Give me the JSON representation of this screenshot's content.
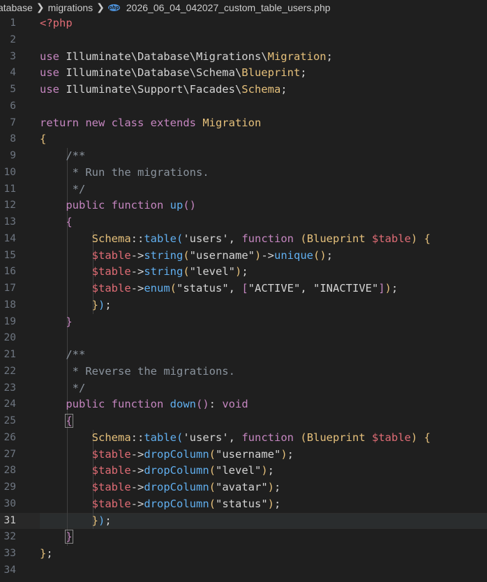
{
  "breadcrumb": {
    "items": [
      "atabase",
      "migrations"
    ],
    "file_icon": "php",
    "file_name": "2026_06_04_042027_custom_table_users.php"
  },
  "editor": {
    "current_line": 31,
    "line_numbers": [
      "1",
      "2",
      "3",
      "4",
      "5",
      "6",
      "7",
      "8",
      "9",
      "10",
      "11",
      "12",
      "13",
      "14",
      "15",
      "16",
      "17",
      "18",
      "19",
      "20",
      "21",
      "22",
      "23",
      "24",
      "25",
      "26",
      "27",
      "28",
      "29",
      "30",
      "31",
      "32",
      "33",
      "34"
    ],
    "lines": [
      [
        {
          "c": "tag",
          "t": "<?php"
        }
      ],
      [],
      [
        {
          "c": "kw",
          "t": "use "
        },
        {
          "c": "ns",
          "t": "Illuminate\\Database\\Migrations\\"
        },
        {
          "c": "cls",
          "t": "Migration"
        },
        {
          "c": "op",
          "t": ";"
        }
      ],
      [
        {
          "c": "kw",
          "t": "use "
        },
        {
          "c": "ns",
          "t": "Illuminate\\Database\\Schema\\"
        },
        {
          "c": "cls",
          "t": "Blueprint"
        },
        {
          "c": "op",
          "t": ";"
        }
      ],
      [
        {
          "c": "kw",
          "t": "use "
        },
        {
          "c": "ns",
          "t": "Illuminate\\Support\\Facades\\"
        },
        {
          "c": "cls",
          "t": "Schema"
        },
        {
          "c": "op",
          "t": ";"
        }
      ],
      [],
      [
        {
          "c": "kw",
          "t": "return "
        },
        {
          "c": "kw",
          "t": "new "
        },
        {
          "c": "kw",
          "t": "class "
        },
        {
          "c": "kw",
          "t": "extends "
        },
        {
          "c": "cls",
          "t": "Migration"
        }
      ],
      [
        {
          "c": "br1",
          "t": "{"
        }
      ],
      [
        {
          "c": "op",
          "t": "    "
        },
        {
          "c": "cmt",
          "t": "/**"
        }
      ],
      [
        {
          "c": "op",
          "t": "     "
        },
        {
          "c": "cmt",
          "t": "* Run the migrations."
        }
      ],
      [
        {
          "c": "op",
          "t": "     "
        },
        {
          "c": "cmt",
          "t": "*/"
        }
      ],
      [
        {
          "c": "op",
          "t": "    "
        },
        {
          "c": "kw",
          "t": "public "
        },
        {
          "c": "kw",
          "t": "function "
        },
        {
          "c": "fn",
          "t": "up"
        },
        {
          "c": "br2",
          "t": "()"
        }
      ],
      [
        {
          "c": "op",
          "t": "    "
        },
        {
          "c": "br2",
          "t": "{"
        }
      ],
      [
        {
          "c": "op",
          "t": "        "
        },
        {
          "c": "cls",
          "t": "Schema"
        },
        {
          "c": "op",
          "t": "::"
        },
        {
          "c": "fn",
          "t": "table"
        },
        {
          "c": "br3",
          "t": "("
        },
        {
          "c": "str",
          "t": "'users'"
        },
        {
          "c": "op",
          "t": ", "
        },
        {
          "c": "kw",
          "t": "function "
        },
        {
          "c": "br1",
          "t": "("
        },
        {
          "c": "cls",
          "t": "Blueprint "
        },
        {
          "c": "var",
          "t": "$table"
        },
        {
          "c": "br1",
          "t": ")"
        },
        {
          "c": "op",
          "t": " "
        },
        {
          "c": "br1",
          "t": "{"
        }
      ],
      [
        {
          "c": "op",
          "t": "        "
        },
        {
          "c": "var",
          "t": "$table"
        },
        {
          "c": "op",
          "t": "->"
        },
        {
          "c": "fn",
          "t": "string"
        },
        {
          "c": "br1",
          "t": "("
        },
        {
          "c": "str",
          "t": "\"username\""
        },
        {
          "c": "br1",
          "t": ")"
        },
        {
          "c": "op",
          "t": "->"
        },
        {
          "c": "fn",
          "t": "unique"
        },
        {
          "c": "br1",
          "t": "()"
        },
        {
          "c": "op",
          "t": ";"
        }
      ],
      [
        {
          "c": "op",
          "t": "        "
        },
        {
          "c": "var",
          "t": "$table"
        },
        {
          "c": "op",
          "t": "->"
        },
        {
          "c": "fn",
          "t": "string"
        },
        {
          "c": "br1",
          "t": "("
        },
        {
          "c": "str",
          "t": "\"level\""
        },
        {
          "c": "br1",
          "t": ")"
        },
        {
          "c": "op",
          "t": ";"
        }
      ],
      [
        {
          "c": "op",
          "t": "        "
        },
        {
          "c": "var",
          "t": "$table"
        },
        {
          "c": "op",
          "t": "->"
        },
        {
          "c": "fn",
          "t": "enum"
        },
        {
          "c": "br1",
          "t": "("
        },
        {
          "c": "str",
          "t": "\"status\""
        },
        {
          "c": "op",
          "t": ", "
        },
        {
          "c": "br2",
          "t": "["
        },
        {
          "c": "str",
          "t": "\"ACTIVE\""
        },
        {
          "c": "op",
          "t": ", "
        },
        {
          "c": "str",
          "t": "\"INACTIVE\""
        },
        {
          "c": "br2",
          "t": "]"
        },
        {
          "c": "br1",
          "t": ")"
        },
        {
          "c": "op",
          "t": ";"
        }
      ],
      [
        {
          "c": "op",
          "t": "        "
        },
        {
          "c": "br1",
          "t": "}"
        },
        {
          "c": "br3",
          "t": ")"
        },
        {
          "c": "op",
          "t": ";"
        }
      ],
      [
        {
          "c": "op",
          "t": "    "
        },
        {
          "c": "br2",
          "t": "}"
        }
      ],
      [],
      [
        {
          "c": "op",
          "t": "    "
        },
        {
          "c": "cmt",
          "t": "/**"
        }
      ],
      [
        {
          "c": "op",
          "t": "     "
        },
        {
          "c": "cmt",
          "t": "* Reverse the migrations."
        }
      ],
      [
        {
          "c": "op",
          "t": "     "
        },
        {
          "c": "cmt",
          "t": "*/"
        }
      ],
      [
        {
          "c": "op",
          "t": "    "
        },
        {
          "c": "kw",
          "t": "public "
        },
        {
          "c": "kw",
          "t": "function "
        },
        {
          "c": "fn",
          "t": "down"
        },
        {
          "c": "br2",
          "t": "()"
        },
        {
          "c": "op",
          "t": ": "
        },
        {
          "c": "type",
          "t": "void"
        }
      ],
      [
        {
          "c": "op",
          "t": "    "
        },
        {
          "c": "br2 boxb",
          "t": "{"
        }
      ],
      [
        {
          "c": "op",
          "t": "        "
        },
        {
          "c": "cls",
          "t": "Schema"
        },
        {
          "c": "op",
          "t": "::"
        },
        {
          "c": "fn",
          "t": "table"
        },
        {
          "c": "br3",
          "t": "("
        },
        {
          "c": "str",
          "t": "'users'"
        },
        {
          "c": "op",
          "t": ", "
        },
        {
          "c": "kw",
          "t": "function "
        },
        {
          "c": "br1",
          "t": "("
        },
        {
          "c": "cls",
          "t": "Blueprint "
        },
        {
          "c": "var",
          "t": "$table"
        },
        {
          "c": "br1",
          "t": ")"
        },
        {
          "c": "op",
          "t": " "
        },
        {
          "c": "br1",
          "t": "{"
        }
      ],
      [
        {
          "c": "op",
          "t": "        "
        },
        {
          "c": "var",
          "t": "$table"
        },
        {
          "c": "op",
          "t": "->"
        },
        {
          "c": "fn",
          "t": "dropColumn"
        },
        {
          "c": "br1",
          "t": "("
        },
        {
          "c": "str",
          "t": "\"username\""
        },
        {
          "c": "br1",
          "t": ")"
        },
        {
          "c": "op",
          "t": ";"
        }
      ],
      [
        {
          "c": "op",
          "t": "        "
        },
        {
          "c": "var",
          "t": "$table"
        },
        {
          "c": "op",
          "t": "->"
        },
        {
          "c": "fn",
          "t": "dropColumn"
        },
        {
          "c": "br1",
          "t": "("
        },
        {
          "c": "str",
          "t": "\"level\""
        },
        {
          "c": "br1",
          "t": ")"
        },
        {
          "c": "op",
          "t": ";"
        }
      ],
      [
        {
          "c": "op",
          "t": "        "
        },
        {
          "c": "var",
          "t": "$table"
        },
        {
          "c": "op",
          "t": "->"
        },
        {
          "c": "fn",
          "t": "dropColumn"
        },
        {
          "c": "br1",
          "t": "("
        },
        {
          "c": "str",
          "t": "\"avatar\""
        },
        {
          "c": "br1",
          "t": ")"
        },
        {
          "c": "op",
          "t": ";"
        }
      ],
      [
        {
          "c": "op",
          "t": "        "
        },
        {
          "c": "var",
          "t": "$table"
        },
        {
          "c": "op",
          "t": "->"
        },
        {
          "c": "fn",
          "t": "dropColumn"
        },
        {
          "c": "br1",
          "t": "("
        },
        {
          "c": "str",
          "t": "\"status\""
        },
        {
          "c": "br1",
          "t": ")"
        },
        {
          "c": "op",
          "t": ";"
        }
      ],
      [
        {
          "c": "op",
          "t": "        "
        },
        {
          "c": "br1",
          "t": "}"
        },
        {
          "c": "br3",
          "t": ")"
        },
        {
          "c": "op",
          "t": ";"
        }
      ],
      [
        {
          "c": "op",
          "t": "    "
        },
        {
          "c": "br2 boxb",
          "t": "}"
        }
      ],
      [
        {
          "c": "br1",
          "t": "}"
        },
        {
          "c": "op",
          "t": ";"
        }
      ],
      []
    ]
  }
}
